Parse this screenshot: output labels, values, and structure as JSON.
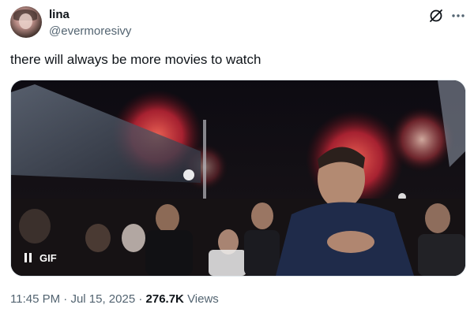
{
  "author": {
    "name": "lina",
    "handle": "@evermoresivy"
  },
  "icons": {
    "header_actions": [
      "grok-icon",
      "more-options-icon"
    ],
    "media_controls": [
      "pause-icon"
    ]
  },
  "tweet": {
    "text": "there will always be more movies to watch"
  },
  "media": {
    "type": "gif",
    "badge": "GIF",
    "playing": true
  },
  "meta": {
    "time": "11:45 PM",
    "separator": "·",
    "date": "Jul 15, 2025",
    "views_count": "276.7K",
    "views_label": "Views"
  },
  "colors": {
    "text_primary": "#0f1419",
    "text_secondary": "#536471",
    "firework_red": "#d8283a"
  }
}
